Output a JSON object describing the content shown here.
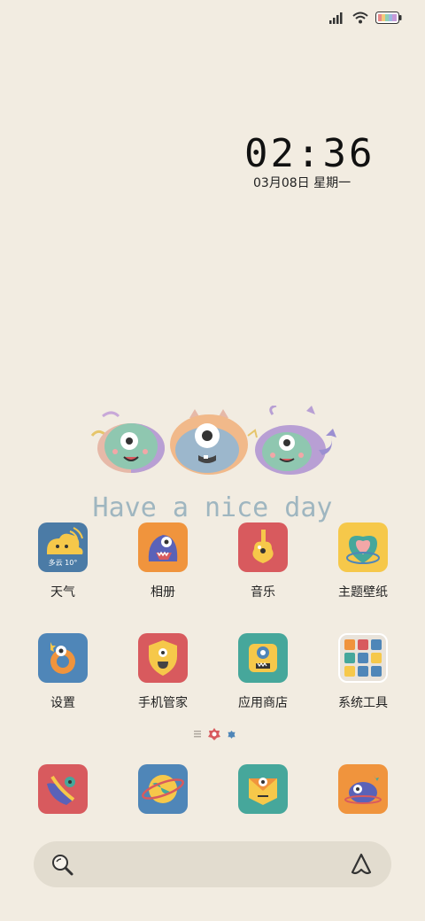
{
  "status_bar": {
    "icons": [
      "signal-icon",
      "wifi-icon",
      "battery-icon"
    ],
    "battery_colors": [
      "#e88a8a",
      "#f3c97a",
      "#8fd1b5",
      "#9ab8e0",
      "#c79ad8"
    ]
  },
  "clock": {
    "time": "02:36",
    "date": "03月08日 星期一"
  },
  "widget": {
    "text": "Have a nice day"
  },
  "apps": [
    {
      "label": "天气",
      "color": "#4b7ba6",
      "badge": "多云 10°"
    },
    {
      "label": "相册",
      "color": "#f0943d"
    },
    {
      "label": "音乐",
      "color": "#d85a5e"
    },
    {
      "label": "主题壁纸",
      "color": "#f6c84a"
    },
    {
      "label": "设置",
      "color": "#4f86b8"
    },
    {
      "label": "手机管家",
      "color": "#d85a5e"
    },
    {
      "label": "应用商店",
      "color": "#46a79b"
    },
    {
      "label": "系统工具",
      "color": "#e9e3da"
    }
  ],
  "dock": [
    {
      "name": "phone",
      "color": "#d85a5e"
    },
    {
      "name": "browser",
      "color": "#4f86b8"
    },
    {
      "name": "messages",
      "color": "#46a79b"
    },
    {
      "name": "camera",
      "color": "#f0943d"
    }
  ],
  "pager": {
    "colors": [
      "#b0a9a0",
      "#d85a5e",
      "#4f86b8"
    ]
  }
}
